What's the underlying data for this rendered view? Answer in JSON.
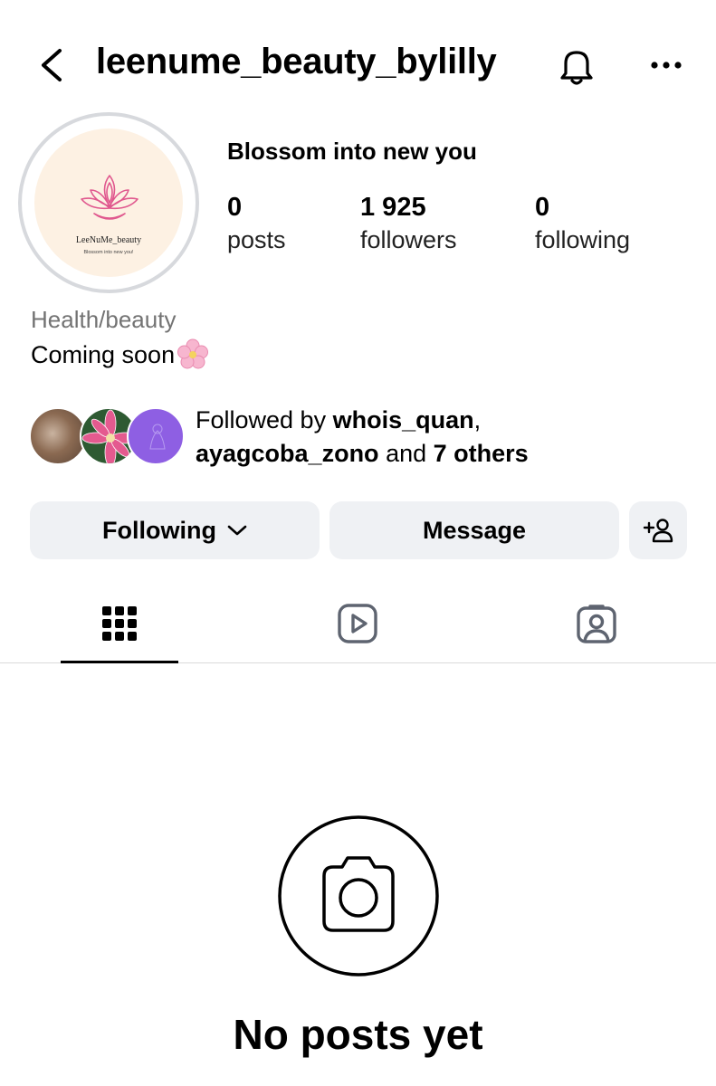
{
  "header": {
    "username": "leenume_beauty_bylilly",
    "back_icon": "chevron-left-icon",
    "bell_icon": "bell-icon",
    "more_icon": "ellipsis-icon"
  },
  "profile": {
    "avatar_logo_text": "LeeNuMe_beauty",
    "avatar_logo_subtext": "Blossom into new you!",
    "full_name": "Blossom into new you",
    "stats": [
      {
        "value": "0",
        "label": "posts"
      },
      {
        "value": "1 925",
        "label": "followers"
      },
      {
        "value": "0",
        "label": "following"
      }
    ],
    "category": "Health/beauty",
    "bio": "Coming soon",
    "bio_emoji": "cherry-blossom-icon"
  },
  "followed_by": {
    "prefix": "Followed by ",
    "user1": "whois_quan",
    "comma": ",",
    "user2": "ayagcoba_zono",
    "and": " and ",
    "others": "7 others"
  },
  "actions": {
    "following_label": "Following",
    "message_label": "Message",
    "add_user_icon": "add-person-icon"
  },
  "tabs": [
    {
      "name": "grid",
      "icon": "grid-icon",
      "active": true
    },
    {
      "name": "reels",
      "icon": "reels-icon",
      "active": false
    },
    {
      "name": "tagged",
      "icon": "tagged-icon",
      "active": false
    }
  ],
  "empty_state": {
    "text": "No posts yet",
    "icon": "camera-icon"
  },
  "colors": {
    "button_bg": "#eff1f4",
    "muted_text": "#737373",
    "avatar_bg": "#fdf1e3",
    "logo_pink": "#e0588e"
  }
}
